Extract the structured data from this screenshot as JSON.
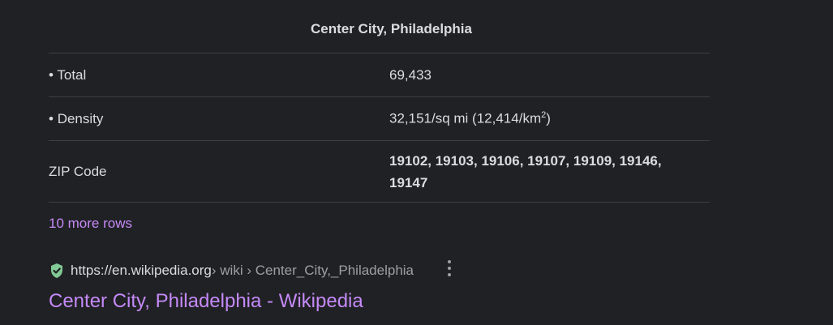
{
  "infobox": {
    "caption": "Center City, Philadelphia",
    "rows": [
      {
        "label": "Total",
        "value": "69,433"
      },
      {
        "label": "Density",
        "value_main": "32,151/sq mi (12,414/km",
        "value_sup": "2",
        "value_end": ")"
      },
      {
        "label": "ZIP Code",
        "value": "19102, 19103, 19106, 19107, 19109, 19146, 19147"
      }
    ],
    "more_rows": "10 more rows"
  },
  "result": {
    "host": "https://en.wikipedia.org",
    "path": " › wiki › Center_City,_Philadelphia",
    "title": "Center City, Philadelphia - Wikipedia",
    "icons": {
      "verified": "shield-check-icon",
      "menu": "more-vert-icon"
    }
  },
  "colors": {
    "background": "#202124",
    "link": "#c58af9",
    "verified": "#81c995"
  }
}
